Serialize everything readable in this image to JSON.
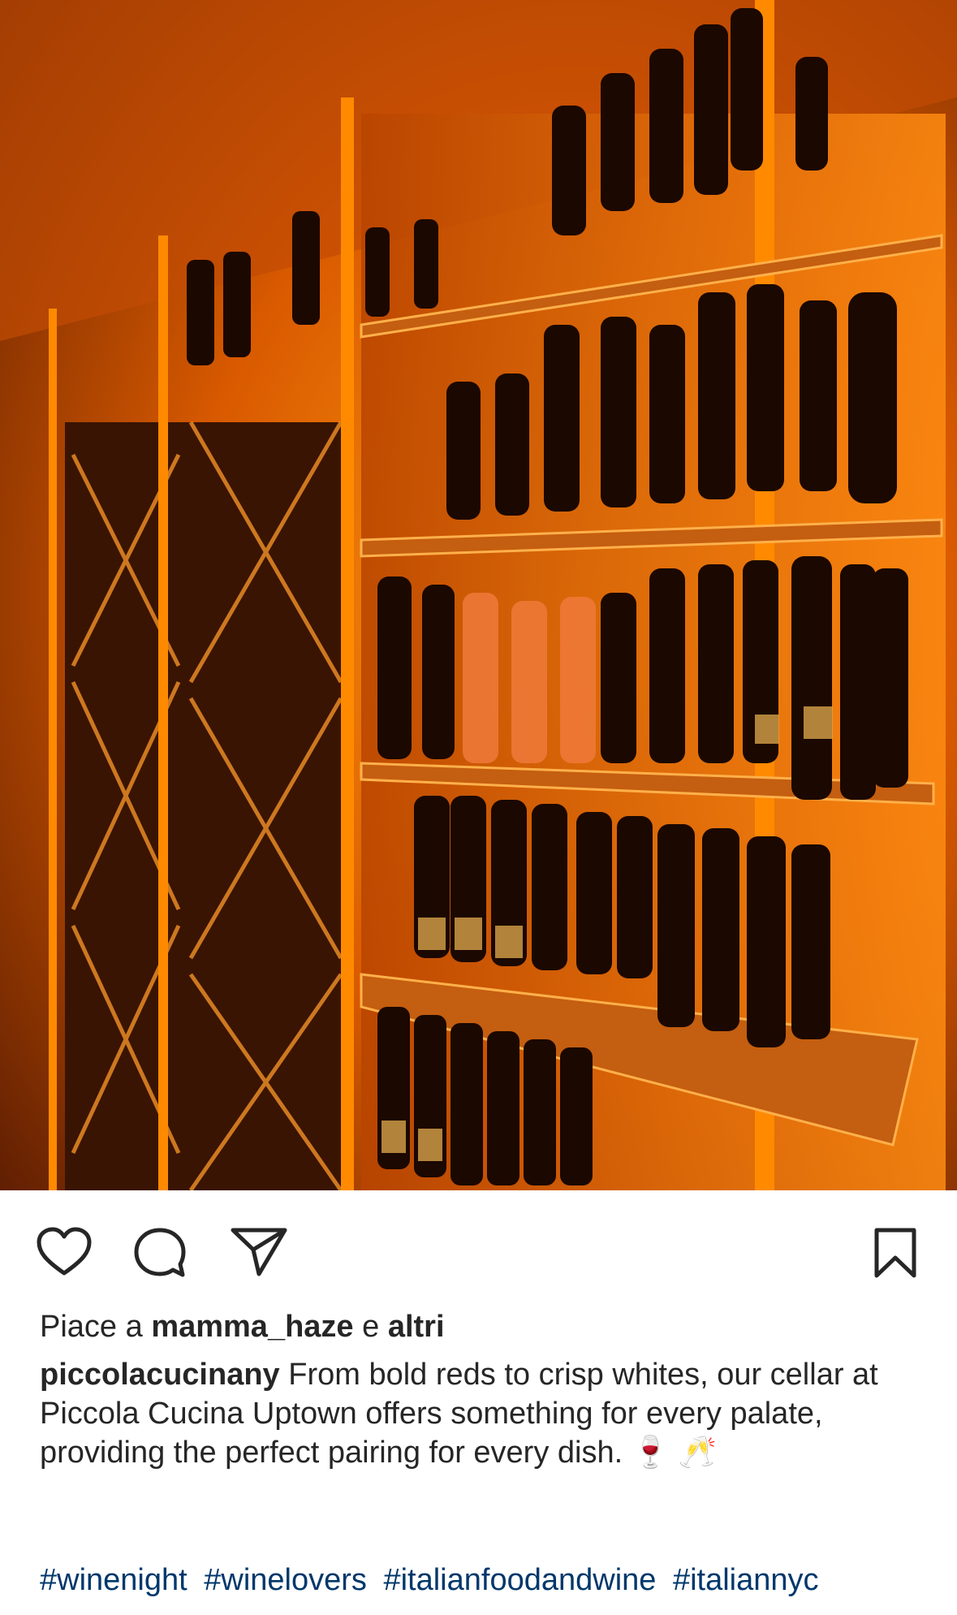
{
  "post": {
    "image_alt": "Wine cellar shelves lit in orange with rows of bottles",
    "actions": {
      "like_icon": "heart-outline-icon",
      "comment_icon": "speech-bubble-icon",
      "share_icon": "paper-plane-icon",
      "save_icon": "bookmark-outline-icon"
    },
    "likes": {
      "prefix": "Piace a",
      "user": "mamma_haze",
      "connector": "e",
      "others": "altri"
    },
    "caption": {
      "username": "piccolacucinany",
      "text": "From bold reds to crisp whites, our cellar at Piccola Cucina Uptown offers something for every palate, providing the perfect pairing for every dish.",
      "emojis": "🍷 🥂"
    },
    "hashtags": [
      "#winenight",
      "#winelovers",
      "#italianfoodandwine",
      "#italiannyc"
    ]
  },
  "colors": {
    "text": "#262626",
    "hashtag": "#00376b",
    "photo_glow": "#ff8a00"
  }
}
